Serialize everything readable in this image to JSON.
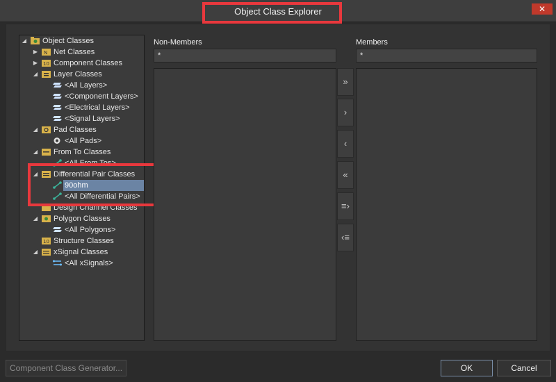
{
  "window": {
    "title": "Object Class Explorer",
    "close_glyph": "✕"
  },
  "tree": {
    "root_label": "Object Classes",
    "items": [
      {
        "label": "Net Classes"
      },
      {
        "label": "Component Classes"
      },
      {
        "label": "Layer Classes"
      },
      {
        "label": "<All Layers>"
      },
      {
        "label": "<Component Layers>"
      },
      {
        "label": "<Electrical Layers>"
      },
      {
        "label": "<Signal Layers>"
      },
      {
        "label": "Pad Classes"
      },
      {
        "label": "<All Pads>"
      },
      {
        "label": "From To Classes"
      },
      {
        "label": "<All From Tos>"
      },
      {
        "label": "Differential Pair Classes"
      },
      {
        "label": "90ohm"
      },
      {
        "label": "<All Differential Pairs>"
      },
      {
        "label": "Design Channel Classes"
      },
      {
        "label": "Polygon Classes"
      },
      {
        "label": "<All Polygons>"
      },
      {
        "label": "Structure Classes"
      },
      {
        "label": "xSignal Classes"
      },
      {
        "label": "<All xSignals>"
      }
    ]
  },
  "non_members": {
    "title": "Non-Members",
    "filter": "*"
  },
  "members": {
    "title": "Members",
    "filter": "*"
  },
  "move_buttons": {
    "add_all": "»",
    "add": "›",
    "remove": "‹",
    "remove_all": "«",
    "add_selected": "≡›",
    "remove_selected": "‹≡"
  },
  "footer": {
    "generator_label": "Component Class Generator...",
    "ok_label": "OK",
    "cancel_label": "Cancel"
  },
  "colors": {
    "highlight": "#e8383d",
    "selection": "#6b84a4",
    "close": "#c0392b"
  }
}
